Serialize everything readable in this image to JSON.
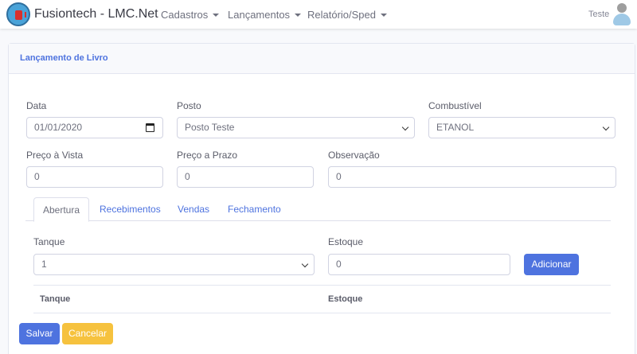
{
  "app": {
    "title": "Fusiontech - LMC.Net"
  },
  "nav": {
    "items": [
      {
        "label": "Cadastros"
      },
      {
        "label": "Lançamentos"
      },
      {
        "label": "Relatório/Sped"
      }
    ],
    "user": "Teste"
  },
  "card": {
    "title": "Lançamento de Livro"
  },
  "form": {
    "data_label": "Data",
    "data_value": "01/01/2020",
    "posto_label": "Posto",
    "posto_value": "Posto Teste",
    "combustivel_label": "Combustível",
    "combustivel_value": "ETANOL",
    "preco_vista_label": "Preço à Vista",
    "preco_vista_value": "0",
    "preco_prazo_label": "Preço a Prazo",
    "preco_prazo_value": "0",
    "observacao_label": "Observação",
    "observacao_value": "0"
  },
  "tabs": [
    {
      "label": "Abertura",
      "active": true
    },
    {
      "label": "Recebimentos"
    },
    {
      "label": "Vendas"
    },
    {
      "label": "Fechamento"
    }
  ],
  "abertura": {
    "tanque_label": "Tanque",
    "tanque_value": "1",
    "estoque_label": "Estoque",
    "estoque_value": "0",
    "add_button": "Adicionar",
    "table_headers": [
      "Tanque",
      "Estoque"
    ]
  },
  "actions": {
    "save": "Salvar",
    "cancel": "Cancelar"
  },
  "colors": {
    "primary": "#4e73df",
    "warning": "#f6c23e"
  }
}
